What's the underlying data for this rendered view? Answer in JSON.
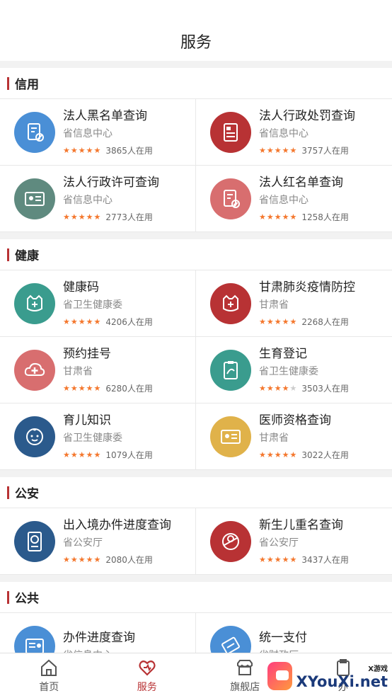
{
  "header": {
    "title": "服务"
  },
  "sections": [
    {
      "title": "信用",
      "items": [
        {
          "name": "法人黑名单查询",
          "org": "省信息中心",
          "count": "3865人在用",
          "rating": 5,
          "icon": "document-ban-icon",
          "color": "#4a8fd6"
        },
        {
          "name": "法人行政处罚查询",
          "org": "省信息中心",
          "count": "3757人在用",
          "rating": 5,
          "icon": "penalty-document-icon",
          "color": "#b83234"
        },
        {
          "name": "法人行政许可查询",
          "org": "省信息中心",
          "count": "2773人在用",
          "rating": 5,
          "icon": "license-card-icon",
          "color": "#5f8a7f"
        },
        {
          "name": "法人红名单查询",
          "org": "省信息中心",
          "count": "1258人在用",
          "rating": 5,
          "icon": "document-check-icon",
          "color": "#d86e6f"
        }
      ]
    },
    {
      "title": "健康",
      "items": [
        {
          "name": "健康码",
          "org": "省卫生健康委",
          "count": "4206人在用",
          "rating": 5,
          "icon": "health-code-icon",
          "color": "#3a9c8e"
        },
        {
          "name": "甘肃肺炎疫情防控",
          "org": "甘肃省",
          "count": "2268人在用",
          "rating": 5,
          "icon": "epidemic-control-icon",
          "color": "#b83234"
        },
        {
          "name": "预约挂号",
          "org": "甘肃省",
          "count": "6280人在用",
          "rating": 5,
          "icon": "medical-cloud-icon",
          "color": "#d86e6f"
        },
        {
          "name": "生育登记",
          "org": "省卫生健康委",
          "count": "3503人在用",
          "rating": 4,
          "icon": "birth-register-icon",
          "color": "#3a9c8e"
        },
        {
          "name": "育儿知识",
          "org": "省卫生健康委",
          "count": "1079人在用",
          "rating": 5,
          "icon": "baby-face-icon",
          "color": "#2b5a8c"
        },
        {
          "name": "医师资格查询",
          "org": "甘肃省",
          "count": "3022人在用",
          "rating": 5,
          "icon": "doctor-license-icon",
          "color": "#e0b24a"
        }
      ]
    },
    {
      "title": "公安",
      "items": [
        {
          "name": "出入境办件进度查询",
          "org": "省公安厅",
          "count": "2080人在用",
          "rating": 5,
          "icon": "passport-icon",
          "color": "#2b5a8c"
        },
        {
          "name": "新生儿重名查询",
          "org": "省公安厅",
          "count": "3437人在用",
          "rating": 5,
          "icon": "newborn-icon",
          "color": "#b83234"
        }
      ]
    },
    {
      "title": "公共",
      "items": [
        {
          "name": "办件进度查询",
          "org": "省信息中心",
          "count": "",
          "rating": 0,
          "icon": "progress-query-icon",
          "color": "#4a8fd6"
        },
        {
          "name": "统一支付",
          "org": "省财政厅",
          "count": "",
          "rating": 0,
          "icon": "payment-icon",
          "color": "#4a8fd6"
        }
      ]
    }
  ],
  "tabbar": [
    {
      "label": "首页",
      "icon": "home-icon",
      "active": false
    },
    {
      "label": "服务",
      "icon": "service-heart-icon",
      "active": true
    },
    {
      "label": "旗舰店",
      "icon": "store-icon",
      "active": false
    },
    {
      "label": "办",
      "icon": "clipboard-icon",
      "active": false
    }
  ],
  "watermark": {
    "small": "X游戏",
    "big": "XYouXi.net"
  }
}
